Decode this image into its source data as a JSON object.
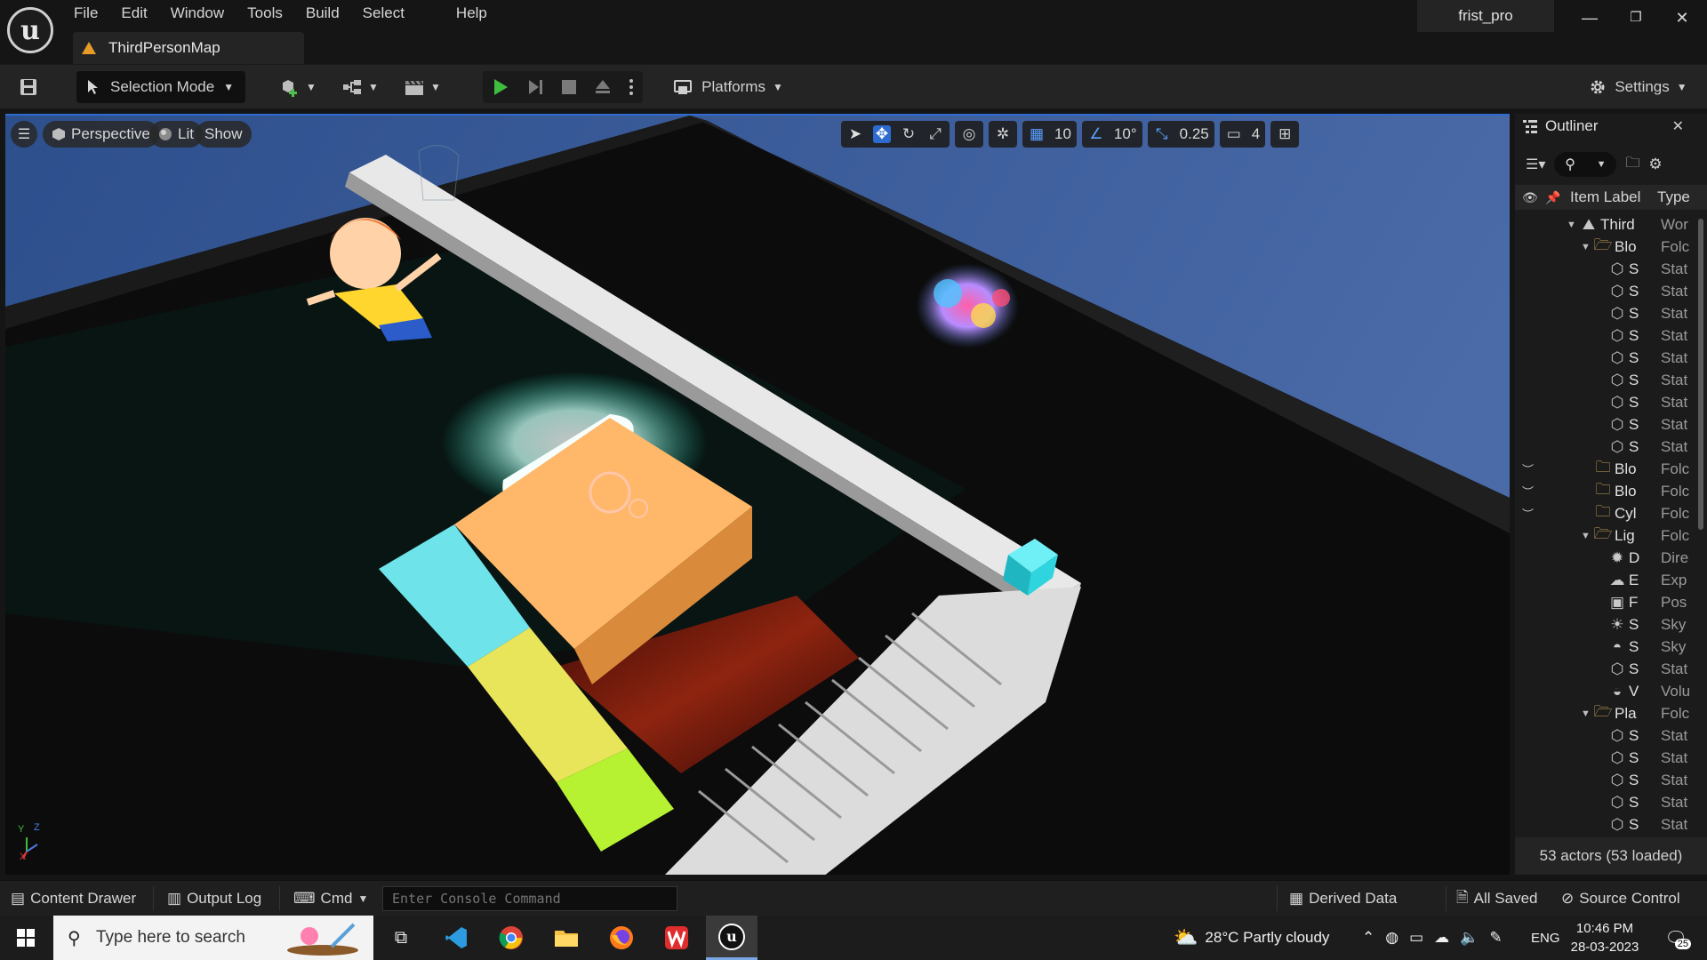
{
  "app": {
    "menu": [
      "File",
      "Edit",
      "Window",
      "Tools",
      "Build",
      "Select",
      "Help"
    ],
    "project_name": "frist_pro",
    "level_tab": "ThirdPersonMap"
  },
  "toolbar": {
    "mode_label": "Selection Mode",
    "platforms_label": "Platforms",
    "settings_label": "Settings"
  },
  "viewport": {
    "view_label": "Perspective",
    "lit_label": "Lit",
    "show_label": "Show",
    "grid_snap": "10",
    "rotation_snap": "10°",
    "scale_snap": "0.25",
    "camera_speed": "4",
    "axis_x": "X",
    "axis_y": "Y",
    "axis_z": "Z"
  },
  "outliner": {
    "title": "Outliner",
    "col_label": "Item Label",
    "col_type": "Type",
    "rows": [
      {
        "name": "Third",
        "type": "Wor",
        "icon": "world-icon",
        "depth": 0,
        "expanded": true
      },
      {
        "name": "Blo",
        "type": "Folc",
        "icon": "folder-open-icon",
        "depth": 1,
        "expanded": true
      },
      {
        "name": "S",
        "type": "Stat",
        "icon": "static-mesh-icon",
        "depth": 2
      },
      {
        "name": "S",
        "type": "Stat",
        "icon": "static-mesh-icon",
        "depth": 2
      },
      {
        "name": "S",
        "type": "Stat",
        "icon": "static-mesh-icon",
        "depth": 2
      },
      {
        "name": "S",
        "type": "Stat",
        "icon": "static-mesh-icon",
        "depth": 2
      },
      {
        "name": "S",
        "type": "Stat",
        "icon": "static-mesh-icon",
        "depth": 2
      },
      {
        "name": "S",
        "type": "Stat",
        "icon": "static-mesh-icon",
        "depth": 2
      },
      {
        "name": "S",
        "type": "Stat",
        "icon": "static-mesh-icon",
        "depth": 2
      },
      {
        "name": "S",
        "type": "Stat",
        "icon": "static-mesh-icon",
        "depth": 2
      },
      {
        "name": "S",
        "type": "Stat",
        "icon": "static-mesh-icon",
        "depth": 2
      },
      {
        "name": "Blo",
        "type": "Folc",
        "icon": "folder-closed-icon",
        "depth": 1,
        "hidden": true
      },
      {
        "name": "Blo",
        "type": "Folc",
        "icon": "folder-closed-icon",
        "depth": 1,
        "hidden": true
      },
      {
        "name": "Cyl",
        "type": "Folc",
        "icon": "folder-closed-icon",
        "depth": 1,
        "hidden": true
      },
      {
        "name": "Lig",
        "type": "Folc",
        "icon": "folder-open-icon",
        "depth": 1,
        "expanded": true
      },
      {
        "name": "D",
        "type": "Dire",
        "icon": "directional-light-icon",
        "depth": 2
      },
      {
        "name": "E",
        "type": "Exp",
        "icon": "exponential-fog-icon",
        "depth": 2
      },
      {
        "name": "F",
        "type": "Pos",
        "icon": "post-process-icon",
        "depth": 2
      },
      {
        "name": "S",
        "type": "Sky",
        "icon": "sky-light-icon",
        "depth": 2
      },
      {
        "name": "S",
        "type": "Sky",
        "icon": "sky-atmosphere-icon",
        "depth": 2
      },
      {
        "name": "S",
        "type": "Stat",
        "icon": "static-mesh-icon",
        "depth": 2
      },
      {
        "name": "V",
        "type": "Volu",
        "icon": "volumetric-cloud-icon",
        "depth": 2
      },
      {
        "name": "Pla",
        "type": "Folc",
        "icon": "folder-open-icon",
        "depth": 1,
        "expanded": true
      },
      {
        "name": "S",
        "type": "Stat",
        "icon": "static-mesh-icon",
        "depth": 2
      },
      {
        "name": "S",
        "type": "Stat",
        "icon": "static-mesh-icon",
        "depth": 2
      },
      {
        "name": "S",
        "type": "Stat",
        "icon": "static-mesh-icon",
        "depth": 2
      },
      {
        "name": "S",
        "type": "Stat",
        "icon": "static-mesh-icon",
        "depth": 2
      },
      {
        "name": "S",
        "type": "Stat",
        "icon": "static-mesh-icon",
        "depth": 2
      }
    ],
    "status": "53 actors (53 loaded)"
  },
  "statusbar": {
    "content_drawer": "Content Drawer",
    "output_log": "Output Log",
    "cmd_label": "Cmd",
    "console_placeholder": "Enter Console Command",
    "derived_data": "Derived Data",
    "all_saved": "All Saved",
    "source_control": "Source Control"
  },
  "taskbar": {
    "search_placeholder": "Type here to search",
    "weather": "28°C  Partly cloudy",
    "language": "ENG",
    "time": "10:46 PM",
    "date": "28-03-2023",
    "notification_count": "25"
  },
  "colors": {
    "accent": "#2d6bd0",
    "play_green": "#3fbd3f",
    "level_tab_icon": "#e69b27",
    "sky": "#3a5a96",
    "cyan_block": "#6fe3ea",
    "orange_block": "#ffb86a",
    "yellow_block": "#e9e55a",
    "green_block": "#b6f232"
  }
}
